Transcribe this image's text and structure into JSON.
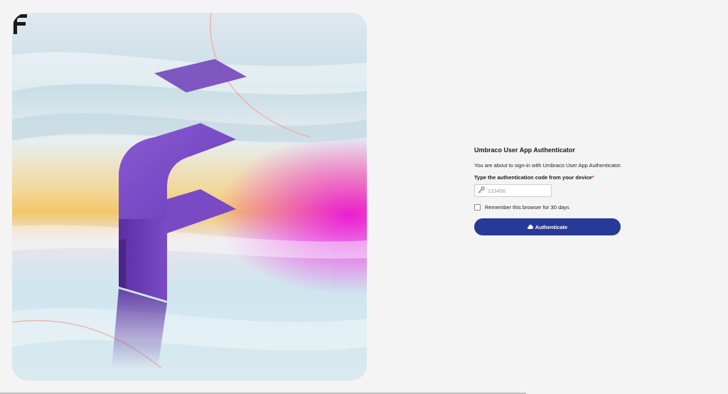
{
  "hero": {
    "logo_icon": "umbraco-f-logo-icon",
    "image_subject": "purple-f-sculpture-icon"
  },
  "form": {
    "title": "Umbraco User App Authenticator",
    "description": "You are about to sign-in with Umbraco User App Authenticator.",
    "code_label": "Type the authentication code from your device",
    "required_marker": "*",
    "code_placeholder": "123456",
    "code_value": "",
    "key_icon": "key-icon",
    "remember_label": "Remember this browser for 30 days",
    "remember_checked": false,
    "submit_label": "Authenticate",
    "submit_icon": "cloud-icon"
  },
  "colors": {
    "accent": "#283a97",
    "required": "#d42054",
    "background": "#f4f4f4",
    "hero_magenta": "#e900e6",
    "hero_gold": "#f3c86a",
    "sculpture_purple": "#6b3fb3"
  }
}
